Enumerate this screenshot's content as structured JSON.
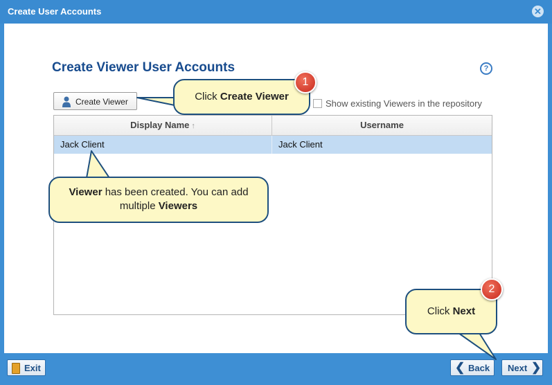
{
  "window": {
    "title": "Create User Accounts",
    "close_glyph": "✕"
  },
  "main": {
    "heading": "Create Viewer User Accounts",
    "help_glyph": "?",
    "create_button_label": "Create Viewer",
    "show_existing_label": "Show existing Viewers in the repository",
    "show_existing_checked": false
  },
  "grid": {
    "columns": [
      "Display Name",
      "Username"
    ],
    "sort_glyph": "↑",
    "rows": [
      {
        "display_name": "Jack Client",
        "username": "Jack Client",
        "selected": true
      }
    ]
  },
  "callouts": {
    "one": {
      "badge": "1",
      "prefix": "Click ",
      "bold": "Create Viewer"
    },
    "two": {
      "bold1": "Viewer",
      "text1": " has been created. You can add multiple ",
      "bold2": "Viewers"
    },
    "three": {
      "badge": "2",
      "prefix": "Click ",
      "bold": "Next"
    }
  },
  "footer": {
    "exit_label": "Exit",
    "back_label": "Back",
    "next_label": "Next",
    "back_glyph": "❮",
    "next_glyph": "❯"
  },
  "colors": {
    "window_blue": "#3e8fd4",
    "heading_blue": "#174b8e",
    "selected_row": "#c2dbf3",
    "callout_fill": "#fdf8c6",
    "badge_red": "#d9392b"
  },
  "icons": [
    "close-icon",
    "help-icon",
    "person-icon",
    "sort-ascending-icon",
    "exit-door-icon",
    "chevron-left-icon",
    "chevron-right-icon"
  ]
}
